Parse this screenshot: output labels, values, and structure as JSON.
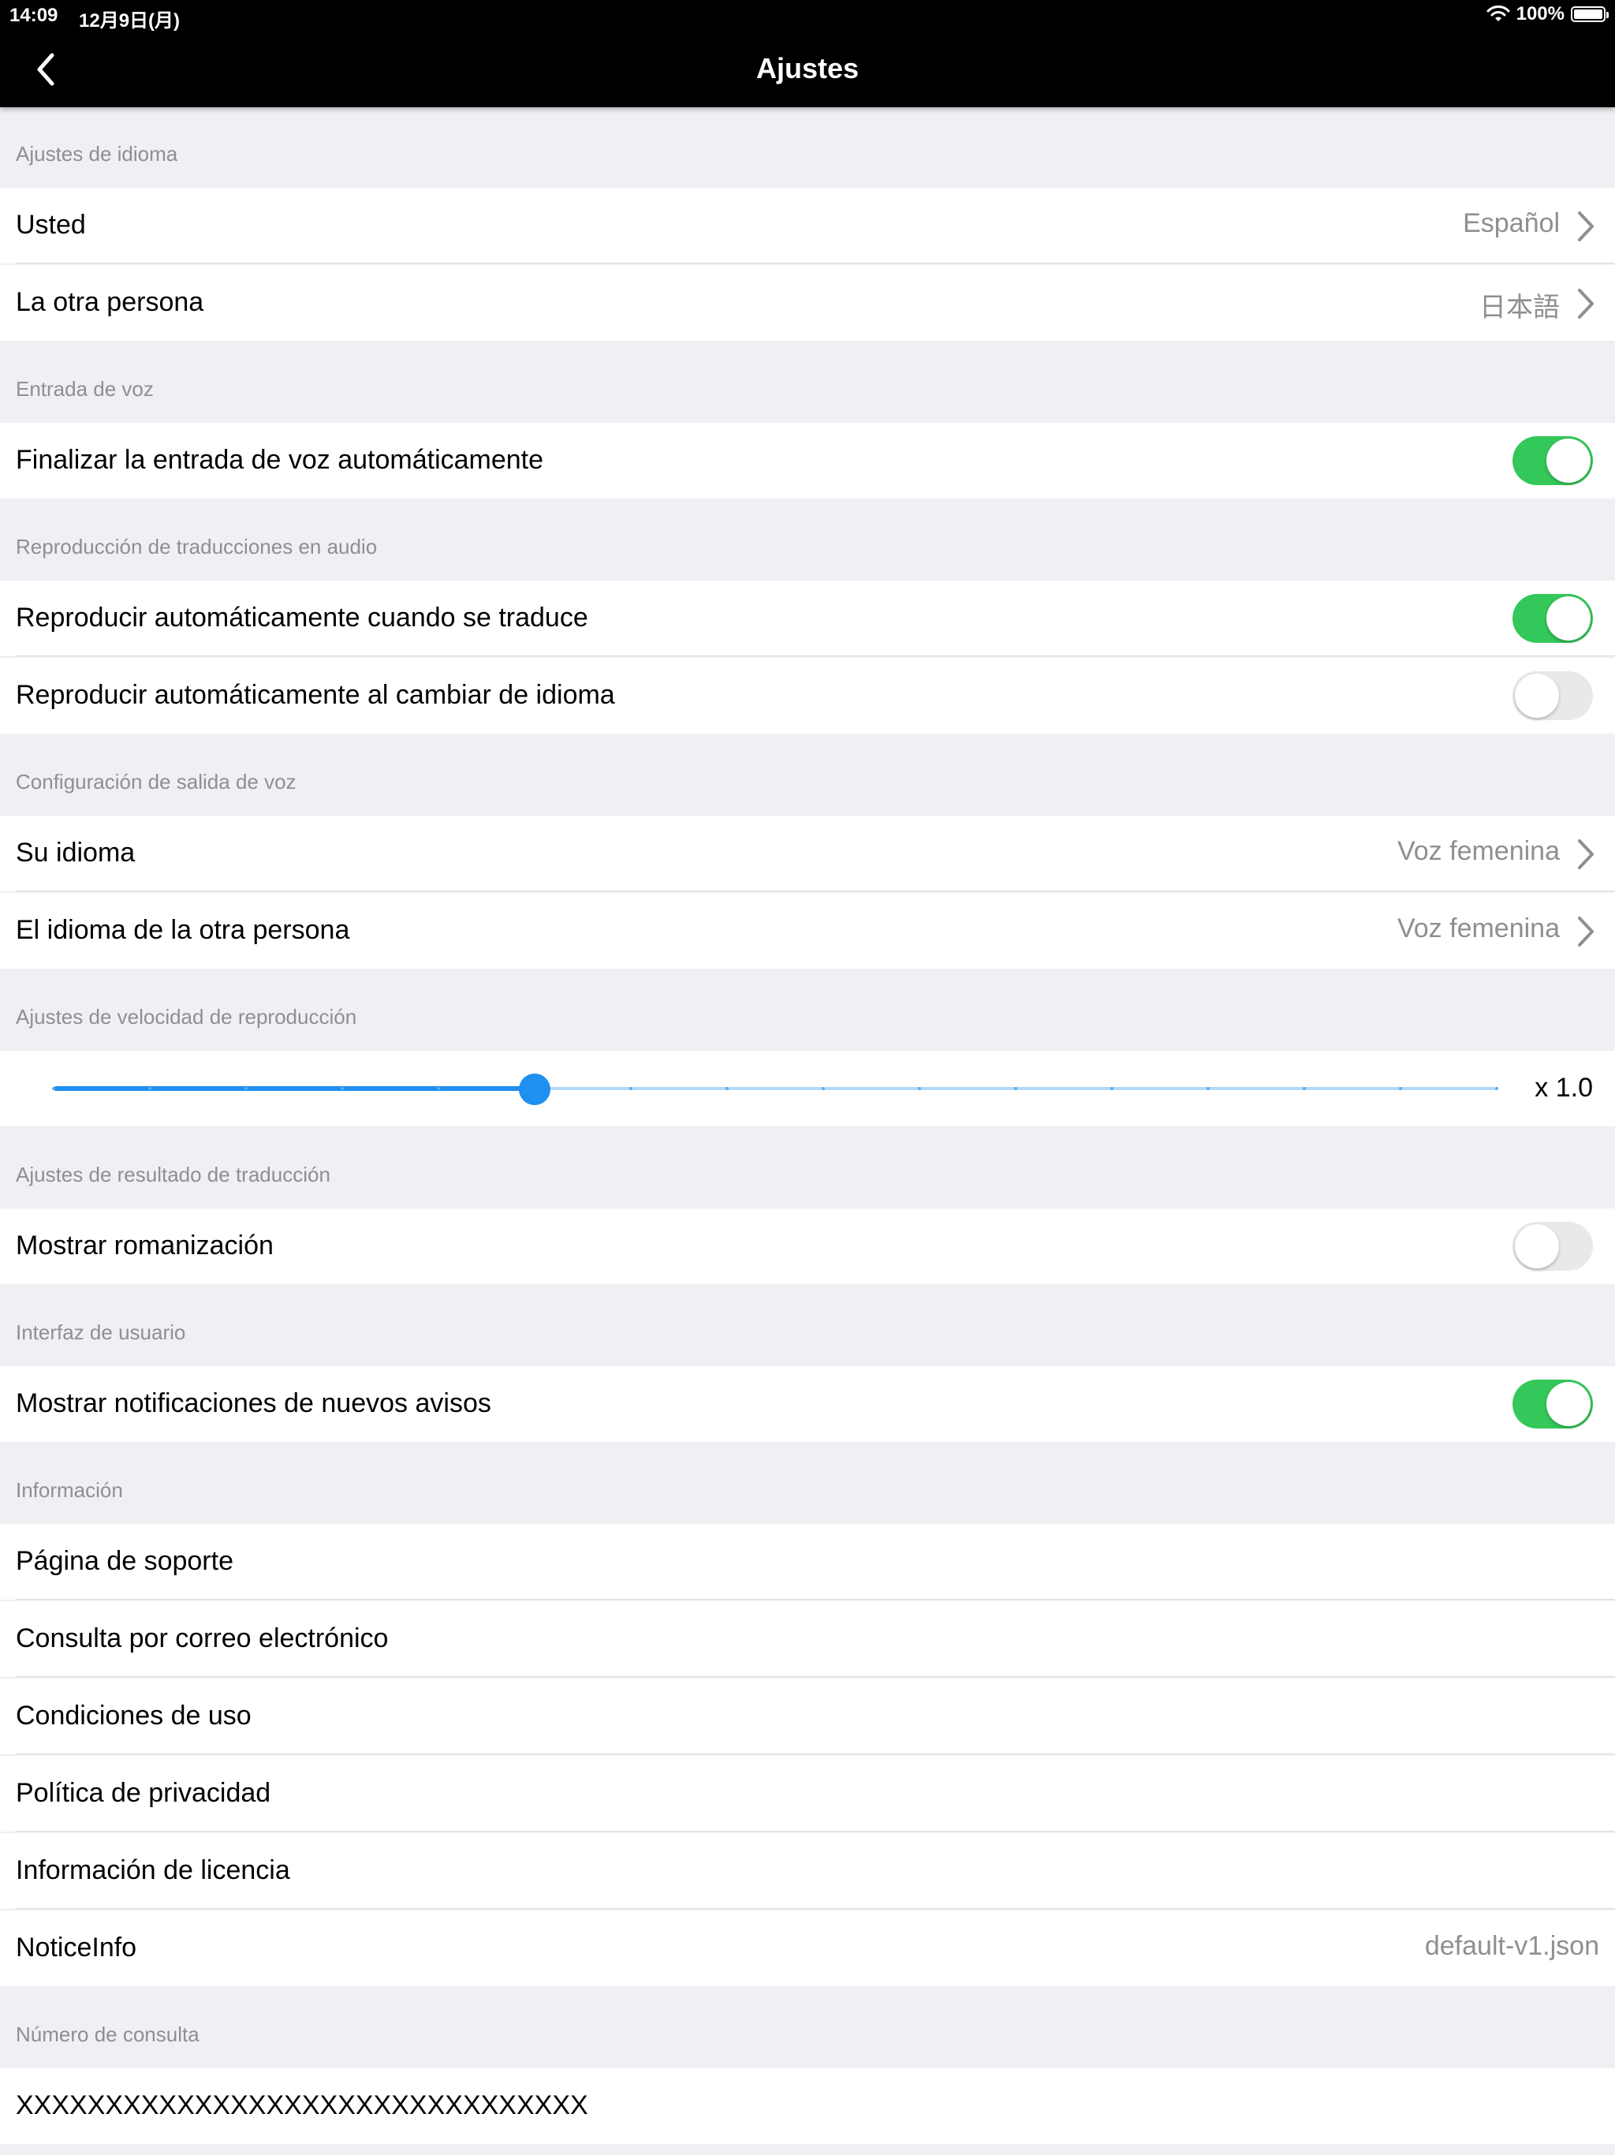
{
  "status_bar": {
    "time": "14:09",
    "date": "12月9日(月)",
    "battery": "100%"
  },
  "nav": {
    "title": "Ajustes"
  },
  "sections": {
    "language": {
      "header": "Ajustes de idioma",
      "you_label": "Usted",
      "you_value": "Español",
      "other_label": "La otra persona",
      "other_value": "日本語"
    },
    "voice_input": {
      "header": "Entrada de voz",
      "auto_end_label": "Finalizar la entrada de voz automáticamente",
      "auto_end_on": true
    },
    "audio_playback": {
      "header": "Reproducción de traducciones en audio",
      "auto_play_label": "Reproducir automáticamente cuando se traduce",
      "auto_play_on": true,
      "auto_play_lang_label": "Reproducir automáticamente al cambiar de idioma",
      "auto_play_lang_on": false
    },
    "voice_output": {
      "header": "Configuración de salida de voz",
      "your_lang_label": "Su idioma",
      "your_lang_value": "Voz femenina",
      "other_lang_label": "El idioma de la otra persona",
      "other_lang_value": "Voz femenina"
    },
    "speed": {
      "header": "Ajustes de velocidad de reproducción",
      "value_label": "x 1.0",
      "slider_fraction": 0.3333
    },
    "translation_result": {
      "header": "Ajustes de resultado de traducción",
      "romanization_label": "Mostrar romanización",
      "romanization_on": false
    },
    "ui": {
      "header": "Interfaz de usuario",
      "notifications_label": "Mostrar notificaciones de nuevos avisos",
      "notifications_on": true
    },
    "info": {
      "header": "Información",
      "support": "Página de soporte",
      "email": "Consulta por correo electrónico",
      "terms": "Condiciones de uso",
      "privacy": "Política de privacidad",
      "license": "Información de licencia",
      "notice_label": "NoticeInfo",
      "notice_value": "default-v1.json"
    },
    "inquiry": {
      "header": "Número de consulta",
      "number": "XXXXXXXXXXXXXXXXXXXXXXXXXXXXXXXX"
    }
  },
  "colors": {
    "toggle_on": "#34c759",
    "toggle_off": "#e9e9ea",
    "slider_accent": "#1f8ff0",
    "background": "#efeff4"
  }
}
